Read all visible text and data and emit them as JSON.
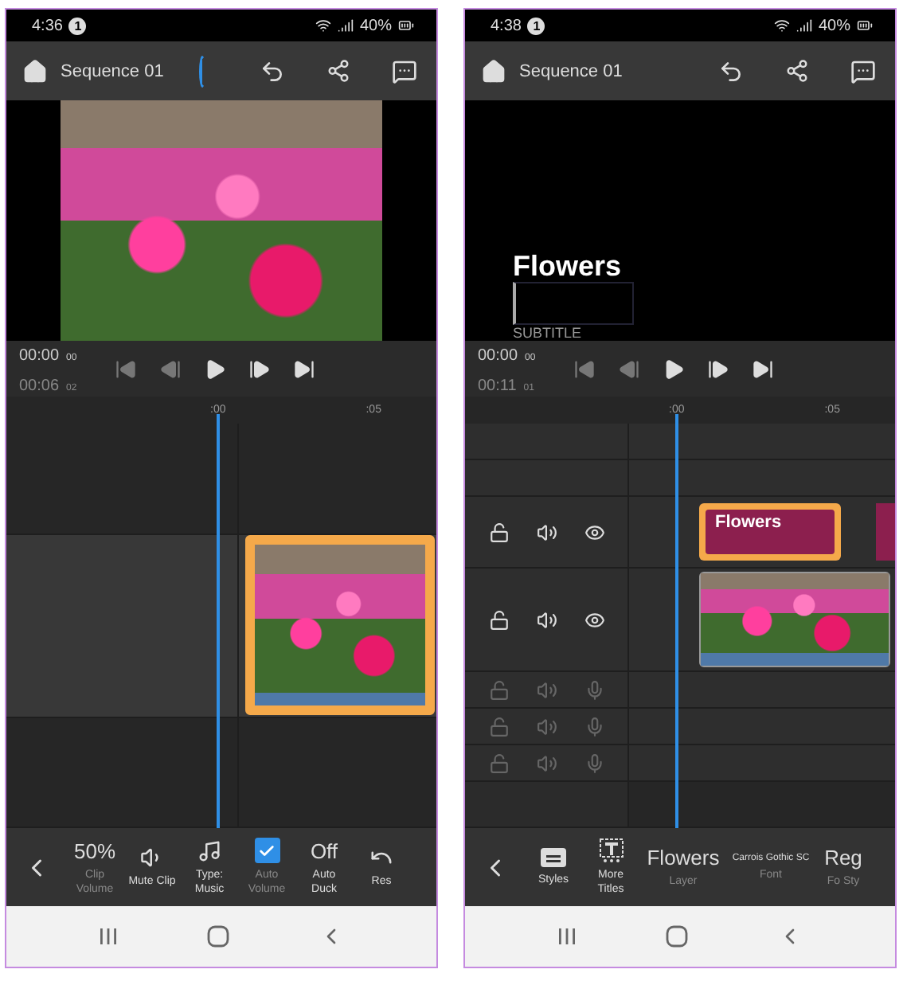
{
  "phones": [
    {
      "status": {
        "time": "4:36",
        "badge": "1",
        "battery": "40%"
      },
      "app_bar": {
        "title": "Sequence 01",
        "processing": true
      },
      "preview": {
        "kind": "photo"
      },
      "transport": {
        "current": "00:00",
        "current_frames": "00",
        "duration": "00:06",
        "duration_frames": "02"
      },
      "ruler": [
        ":00",
        ":05"
      ],
      "tracks": [
        {
          "kind": "spacer"
        },
        {
          "kind": "video",
          "expanded": true,
          "selected": true
        },
        {
          "kind": "spacer"
        }
      ],
      "toolbar": [
        {
          "kind": "value",
          "value": "50%",
          "label": "Clip Volume",
          "disabled": true
        },
        {
          "kind": "speaker",
          "label": "Mute Clip",
          "disabled": false
        },
        {
          "kind": "music",
          "label": "Type: Music",
          "disabled": false
        },
        {
          "kind": "checkbox",
          "checked": true,
          "label": "Auto Volume",
          "disabled": true
        },
        {
          "kind": "value",
          "value": "Off",
          "label": "Auto Duck",
          "disabled": false
        },
        {
          "kind": "reset",
          "label": "Res",
          "disabled": false
        }
      ]
    },
    {
      "status": {
        "time": "4:38",
        "badge": "1",
        "battery": "40%"
      },
      "app_bar": {
        "title": "Sequence 01"
      },
      "preview": {
        "kind": "title",
        "title": "Flowers",
        "subtitle": "SUBTITLE"
      },
      "transport": {
        "current": "00:00",
        "current_frames": "00",
        "duration": "00:11",
        "duration_frames": "01"
      },
      "ruler": [
        ":00",
        ":05"
      ],
      "tracks": [
        {
          "kind": "empty"
        },
        {
          "kind": "empty"
        },
        {
          "kind": "title",
          "text": "Flowers",
          "selected": true,
          "disabled": false
        },
        {
          "kind": "video",
          "expanded": false,
          "selected": false,
          "disabled": false
        },
        {
          "kind": "audio",
          "disabled": true
        },
        {
          "kind": "audio",
          "disabled": true
        },
        {
          "kind": "audio",
          "disabled": true
        },
        {
          "kind": "spacer"
        }
      ],
      "toolbar": [
        {
          "kind": "styles",
          "label": "Styles",
          "disabled": false
        },
        {
          "kind": "titles",
          "label": "More Titles",
          "disabled": false
        },
        {
          "kind": "value",
          "value": "Flowers",
          "label": "Layer",
          "disabled": true
        },
        {
          "kind": "small_value",
          "value": "Carrois Gothic SC",
          "label": "Font",
          "disabled": true
        },
        {
          "kind": "value",
          "value": "Reg",
          "label": "Fo Sty",
          "disabled": true
        }
      ]
    }
  ]
}
